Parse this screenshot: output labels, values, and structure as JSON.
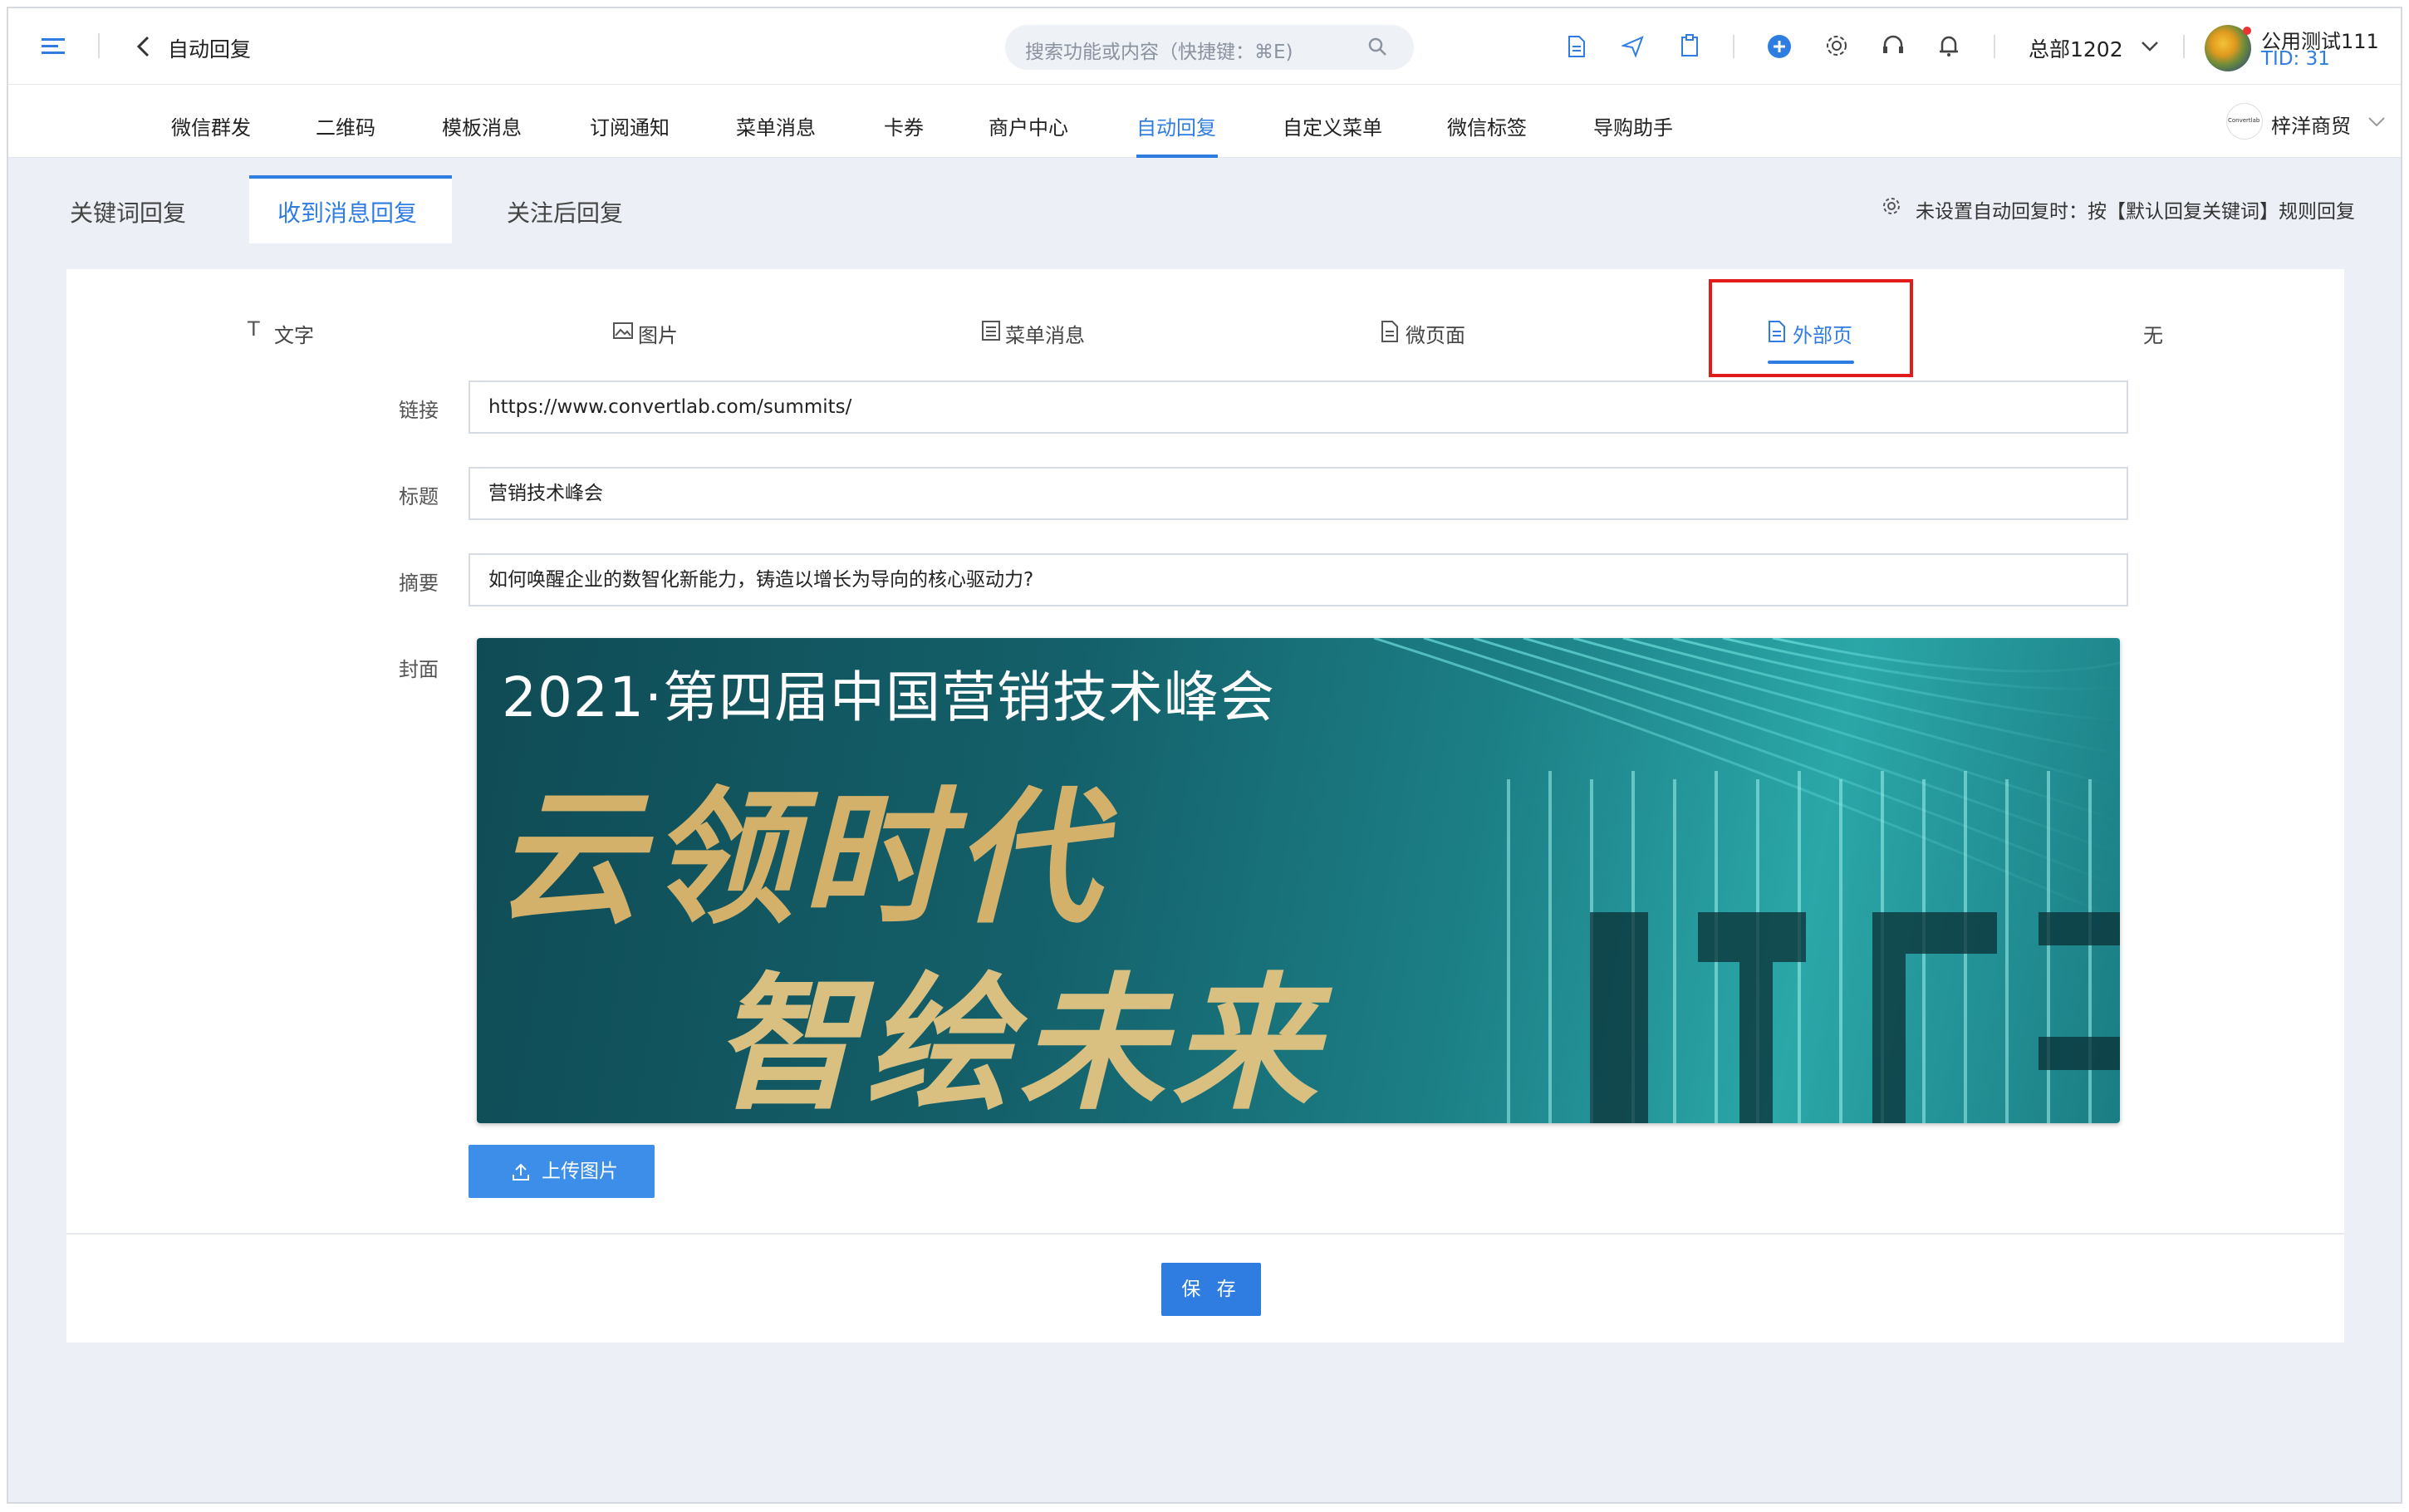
{
  "header": {
    "page_title": "自动回复",
    "search_placeholder": "搜索功能或内容（快捷键：⌘E)",
    "org_name": "总部1202",
    "user_name": "公用测试111",
    "tid": "TID: 31"
  },
  "nav": {
    "items": [
      "微信群发",
      "二维码",
      "模板消息",
      "订阅通知",
      "菜单消息",
      "卡券",
      "商户中心",
      "自动回复",
      "自定义菜单",
      "微信标签",
      "导购助手"
    ],
    "active": "自动回复",
    "account_name": "梓洋商贸",
    "account_logo_text": "Convertlab"
  },
  "tabs": {
    "items": [
      "关键词回复",
      "收到消息回复",
      "关注后回复"
    ],
    "active": "收到消息回复",
    "note": "未设置自动回复时：按【默认回复关键词】规则回复"
  },
  "reply_types": {
    "items": [
      "文字",
      "图片",
      "菜单消息",
      "微页面",
      "外部页",
      "无"
    ],
    "active": "外部页"
  },
  "form": {
    "link_label": "链接",
    "link_value": "https://www.convertlab.com/summits/",
    "title_label": "标题",
    "title_value": "营销技术峰会",
    "summary_label": "摘要",
    "summary_value": "如何唤醒企业的数智化新能力，铸造以增长为导向的核心驱动力?",
    "cover_label": "封面",
    "cover_line1": "2021·第四届中国营销技术峰会",
    "cover_line2": "云领时代",
    "cover_line3": "智绘未来",
    "upload_label": "上传图片",
    "save_label": "保 存"
  },
  "colors": {
    "accent": "#2f7de1",
    "highlight_box": "#e21b1b",
    "cover_gold": "#d4b16a"
  }
}
